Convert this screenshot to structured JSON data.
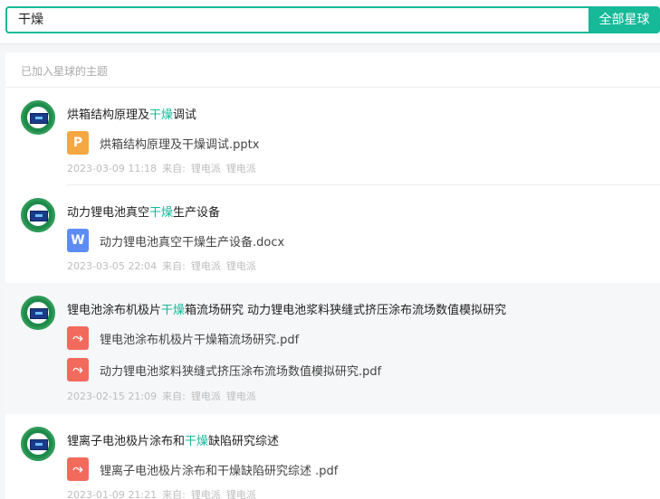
{
  "search": {
    "value": "干燥",
    "button_label": "全部星球"
  },
  "section_label": "已加入星球的主题",
  "results": [
    {
      "title_pre": "烘箱结构原理及",
      "title_kw": "干燥",
      "title_post": "调试",
      "files": [
        {
          "type": "ppt",
          "icon_glyph": "P",
          "name": "烘箱结构原理及干燥调试.pptx"
        }
      ],
      "timestamp": "2023-03-09 11:18",
      "from_label": "来自:",
      "source": "锂电派",
      "source2": "锂电派"
    },
    {
      "title_pre": "动力锂电池真空",
      "title_kw": "干燥",
      "title_post": "生产设备",
      "files": [
        {
          "type": "doc",
          "icon_glyph": "W",
          "name": "动力锂电池真空干燥生产设备.docx"
        }
      ],
      "timestamp": "2023-03-05 22:04",
      "from_label": "来自:",
      "source": "锂电派",
      "source2": "锂电派"
    },
    {
      "title_pre": "锂电池涂布机极片",
      "title_kw": "干燥",
      "title_post": "箱流场研究 动力锂电池浆料狭缝式挤压涂布流场数值模拟研究",
      "files": [
        {
          "type": "pdf",
          "icon_glyph": "⤳",
          "name": "锂电池涂布机极片干燥箱流场研究.pdf"
        },
        {
          "type": "pdf",
          "icon_glyph": "⤳",
          "name": "动力锂电池浆料狭缝式挤压涂布流场数值模拟研究.pdf"
        }
      ],
      "timestamp": "2023-02-15 21:09",
      "from_label": "来自:",
      "source": "锂电派",
      "source2": "锂电派"
    },
    {
      "title_pre": "锂离子电池极片涂布和",
      "title_kw": "干燥",
      "title_post": "缺陷研究综述",
      "files": [
        {
          "type": "pdf",
          "icon_glyph": "⤳",
          "name": "锂离子电池极片涂布和干燥缺陷研究综述 .pdf"
        }
      ],
      "timestamp": "2023-01-09 21:21",
      "from_label": "来自:",
      "source": "锂电派",
      "source2": "锂电派"
    }
  ],
  "colors": {
    "accent": "#16b998",
    "ppt": "#f5a742",
    "doc": "#5d8cf5",
    "pdf": "#f26a5c"
  }
}
